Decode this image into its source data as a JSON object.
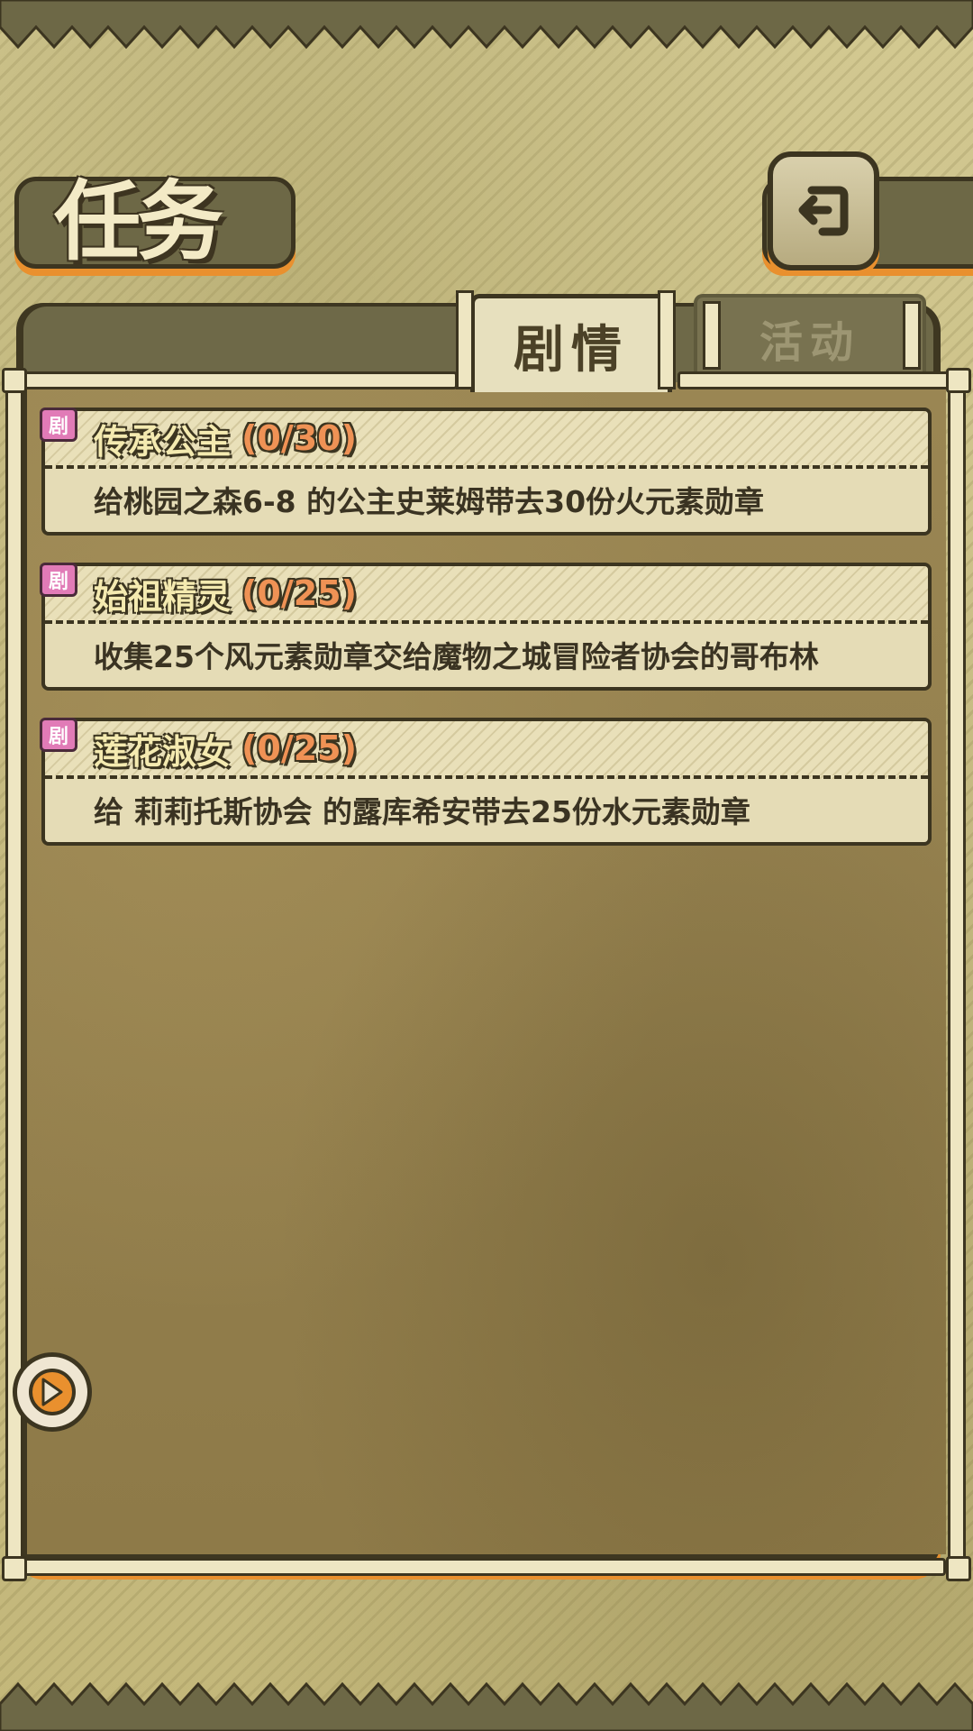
{
  "header": {
    "title": "任务",
    "back_icon": "return-arrow-icon"
  },
  "tabs": [
    {
      "label": "剧情",
      "active": true
    },
    {
      "label": "活动",
      "active": false
    }
  ],
  "quests": [
    {
      "badge": "剧",
      "name": "传承公主",
      "progress": "(0/30)",
      "description": "给桃园之森6-8 的公主史莱姆带去30份火元素勋章"
    },
    {
      "badge": "剧",
      "name": "始祖精灵",
      "progress": "(0/25)",
      "description": "收集25个风元素勋章交给魔物之城冒险者协会的哥布林"
    },
    {
      "badge": "剧",
      "name": "莲花淑女",
      "progress": "(0/25)",
      "description": "给 莉莉托斯协会 的露库希安带去25份水元素勋章"
    }
  ],
  "colors": {
    "frame": "#3c3520",
    "accent_orange": "#e9902e",
    "progress_text": "#ef9255",
    "badge_pink": "#e17bb7"
  },
  "icons": {
    "scroll_button": "arrow-corner-icon"
  }
}
